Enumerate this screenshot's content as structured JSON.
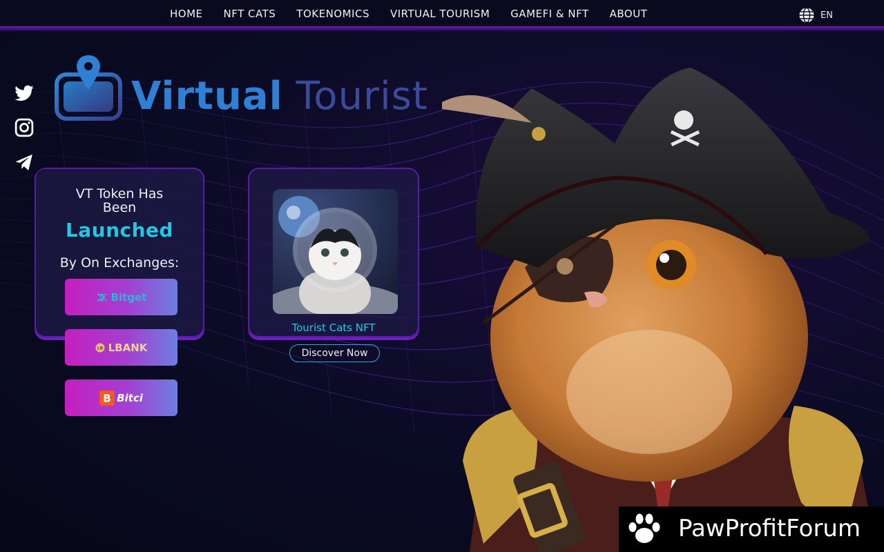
{
  "nav": {
    "items": [
      {
        "label": "HOME"
      },
      {
        "label": "NFT CATS"
      },
      {
        "label": "TOKENOMICS"
      },
      {
        "label": "VIRTUAL TOURISM"
      },
      {
        "label": "GAMEFI & NFT"
      },
      {
        "label": "ABOUT"
      }
    ],
    "language": "EN"
  },
  "logo": {
    "word1": "Virtual",
    "word2": "Tourist"
  },
  "token_card": {
    "heading": "VT Token Has Been",
    "status": "Launched",
    "exchanges_label": "By On Exchanges:"
  },
  "exchanges": [
    {
      "name": "Bitget"
    },
    {
      "name": "LBANK"
    },
    {
      "name": "Bitci"
    }
  ],
  "nft_card": {
    "title": "Tourist Cats NFT",
    "cta": "Discover Now"
  },
  "watermark": {
    "text": "PawProfitForum"
  },
  "colors": {
    "accent_cyan": "#23c8e0",
    "nav_bg": "#0a0a1f",
    "card_border": "#5b1aa8",
    "button_gradient_start": "#c51fc0",
    "button_gradient_end": "#6d7fe0"
  }
}
